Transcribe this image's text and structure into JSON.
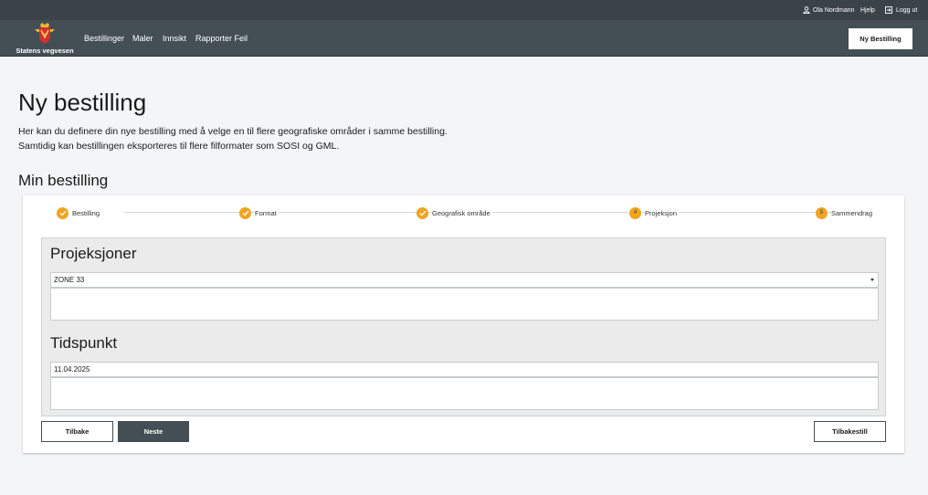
{
  "header": {
    "user_name": "Ola Nordmann",
    "help": "Hjelp",
    "logout": "Logg ut",
    "brand": "Statens vegvesen",
    "nav": [
      "Bestillinger",
      "Maler",
      "Innsikt",
      "Rapporter Feil"
    ],
    "new_order_button": "Ny Bestilling"
  },
  "page": {
    "title": "Ny bestilling",
    "intro_line1": "Her kan du definere din nye bestilling med å velge en til flere geografiske områder i samme bestilling.",
    "intro_line2": "Samtidig kan bestillingen eksporteres til flere filformater som SOSI og GML.",
    "section_title": "Min bestilling"
  },
  "stepper": [
    {
      "label": "Bestilling",
      "state": "done"
    },
    {
      "label": "Format",
      "state": "done"
    },
    {
      "label": "Geografisk område",
      "state": "done"
    },
    {
      "label": "Projeksjon",
      "state": "current",
      "number": "4"
    },
    {
      "label": "Sammendrag",
      "state": "pending",
      "number": "5"
    }
  ],
  "form": {
    "projection_heading": "Projeksjoner",
    "projection_value": "ZONE 33",
    "time_heading": "Tidspunkt",
    "time_value": "11.04.2025"
  },
  "buttons": {
    "back": "Tilbake",
    "next": "Neste",
    "reset": "Tilbakestill"
  },
  "colors": {
    "header_bg": "#444f55",
    "topbar_bg": "#3b4349",
    "accent": "#f0a520",
    "page_bg": "#f4f5f6"
  }
}
